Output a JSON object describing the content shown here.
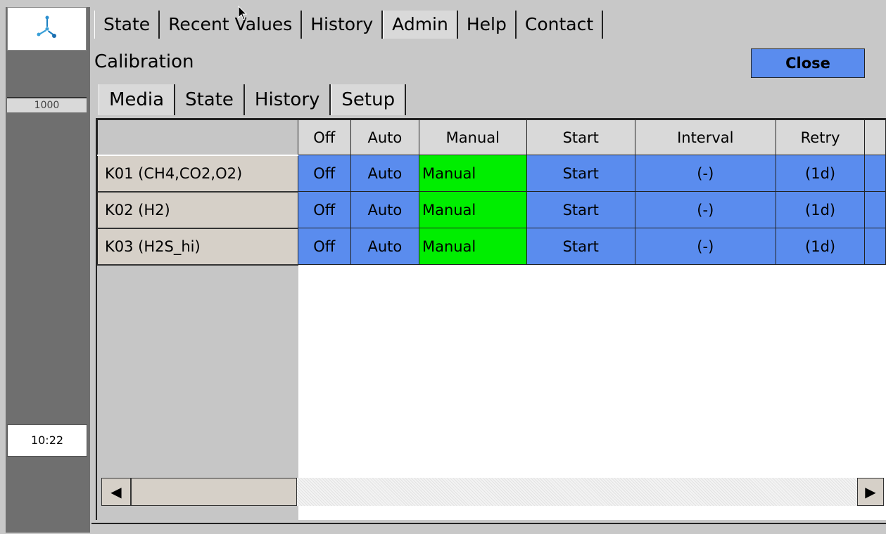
{
  "sidebar": {
    "counter": "1000",
    "clock": "10:22",
    "logo_icon": "propeller-logo-icon"
  },
  "main_tabs": [
    {
      "label": "State"
    },
    {
      "label": "Recent Values"
    },
    {
      "label": "History"
    },
    {
      "label": "Admin"
    },
    {
      "label": "Help"
    },
    {
      "label": "Contact"
    }
  ],
  "active_main_tab": "Admin",
  "page": {
    "title": "Calibration",
    "close_label": "Close"
  },
  "sub_tabs": [
    {
      "label": "Media"
    },
    {
      "label": "State"
    },
    {
      "label": "History"
    },
    {
      "label": "Setup"
    }
  ],
  "active_sub_tab": "Setup",
  "grid": {
    "columns": [
      "Off",
      "Auto",
      "Manual",
      "Start",
      "Interval",
      "Retry"
    ],
    "rows": [
      {
        "name": "K01 (CH4,CO2,O2)",
        "off": "Off",
        "auto": "Auto",
        "manual": "Manual",
        "start": "Start",
        "interval": "(-)",
        "retry": "(1d)"
      },
      {
        "name": "K02 (H2)",
        "off": "Off",
        "auto": "Auto",
        "manual": "Manual",
        "start": "Start",
        "interval": "(-)",
        "retry": "(1d)"
      },
      {
        "name": "K03 (H2S_hi)",
        "off": "Off",
        "auto": "Auto",
        "manual": "Manual",
        "start": "Start",
        "interval": "(-)",
        "retry": "(1d)"
      }
    ]
  },
  "colors": {
    "button_blue": "#5a8cee",
    "active_green": "#00ee00",
    "background": "#c8c8c8"
  }
}
